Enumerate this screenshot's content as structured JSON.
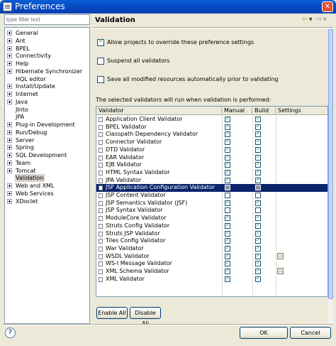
{
  "window": {
    "title": "Preferences",
    "close_glyph": "✕"
  },
  "filter": {
    "placeholder": "type filter text"
  },
  "tree": [
    {
      "label": "General",
      "expandable": true
    },
    {
      "label": "Ant",
      "expandable": true
    },
    {
      "label": "BPEL",
      "expandable": true
    },
    {
      "label": "Connectivity",
      "expandable": true
    },
    {
      "label": "Help",
      "expandable": true
    },
    {
      "label": "Hibernate Synchronizer",
      "expandable": true
    },
    {
      "label": "HQL editor",
      "expandable": false
    },
    {
      "label": "Install/Update",
      "expandable": true
    },
    {
      "label": "Internet",
      "expandable": true
    },
    {
      "label": "Java",
      "expandable": true
    },
    {
      "label": "JInto",
      "expandable": false
    },
    {
      "label": "JPA",
      "expandable": false
    },
    {
      "label": "Plug-in Development",
      "expandable": true
    },
    {
      "label": "Run/Debug",
      "expandable": true
    },
    {
      "label": "Server",
      "expandable": true
    },
    {
      "label": "Spring",
      "expandable": true
    },
    {
      "label": "SQL Development",
      "expandable": true
    },
    {
      "label": "Team",
      "expandable": true
    },
    {
      "label": "Tomcat",
      "expandable": true
    },
    {
      "label": "Validation",
      "expandable": false,
      "selected": true
    },
    {
      "label": "Web and XML",
      "expandable": true
    },
    {
      "label": "Web Services",
      "expandable": true
    },
    {
      "label": "XDoclet",
      "expandable": true
    }
  ],
  "page": {
    "title": "Validation",
    "allow_override": "Allow projects to override these preference settings",
    "suspend_all": "Suspend all validators",
    "save_all": "Save all modified resources automatically prior to validating",
    "hint": "The selected validators will run when validation is performed:"
  },
  "checks": {
    "allow_override": true,
    "suspend_all": false,
    "save_all": false
  },
  "table": {
    "headers": [
      "Validator",
      "Manual",
      "Build",
      "Settings"
    ],
    "rows": [
      {
        "name": "Application Client Validator",
        "manual": true,
        "build": true,
        "settings": false
      },
      {
        "name": "BPEL Validator",
        "manual": true,
        "build": true,
        "settings": false
      },
      {
        "name": "Classpath Dependency Validator",
        "manual": true,
        "build": true,
        "settings": false
      },
      {
        "name": "Connector Validator",
        "manual": true,
        "build": true,
        "settings": false
      },
      {
        "name": "DTD Validator",
        "manual": true,
        "build": true,
        "settings": false
      },
      {
        "name": "EAR Validator",
        "manual": true,
        "build": true,
        "settings": false
      },
      {
        "name": "EJB Validator",
        "manual": true,
        "build": true,
        "settings": false
      },
      {
        "name": "HTML Syntax Validator",
        "manual": true,
        "build": true,
        "settings": false
      },
      {
        "name": "JPA Validator",
        "manual": true,
        "build": true,
        "settings": false
      },
      {
        "name": "JSF Application Configuration Validator",
        "manual": false,
        "build": false,
        "settings": false,
        "selected": true
      },
      {
        "name": "JSP Content Validator",
        "manual": false,
        "build": false,
        "settings": false
      },
      {
        "name": "JSP Semantics Validator (JSF)",
        "manual": true,
        "build": true,
        "settings": false
      },
      {
        "name": "JSP Syntax Validator",
        "manual": false,
        "build": false,
        "settings": false
      },
      {
        "name": "ModuleCore Validator",
        "manual": true,
        "build": true,
        "settings": false
      },
      {
        "name": "Struts Config Validator",
        "manual": true,
        "build": true,
        "settings": false
      },
      {
        "name": "Struts JSP Validator",
        "manual": true,
        "build": true,
        "settings": false
      },
      {
        "name": "Tiles Config Validator",
        "manual": true,
        "build": true,
        "settings": false
      },
      {
        "name": "War Validator",
        "manual": true,
        "build": true,
        "settings": false
      },
      {
        "name": "WSDL Validator",
        "manual": true,
        "build": true,
        "settings": true
      },
      {
        "name": "WS-I Message Validator",
        "manual": true,
        "build": true,
        "settings": false
      },
      {
        "name": "XML Schema Validator",
        "manual": true,
        "build": true,
        "settings": true
      },
      {
        "name": "XML Validator",
        "manual": true,
        "build": true,
        "settings": false
      }
    ]
  },
  "buttons": {
    "enable_all": "Enable All",
    "disable_all": "Disable All",
    "ok": "OK",
    "cancel": "Cancel",
    "settings_glyph": "..."
  },
  "icons": {
    "back": "back-arrow-icon",
    "forward": "forward-arrow-icon",
    "help": "help-icon",
    "help_glyph": "?"
  },
  "colors": {
    "titlebar": "#0846c0",
    "selection": "#0a246a",
    "dialog": "#ece9d8"
  }
}
